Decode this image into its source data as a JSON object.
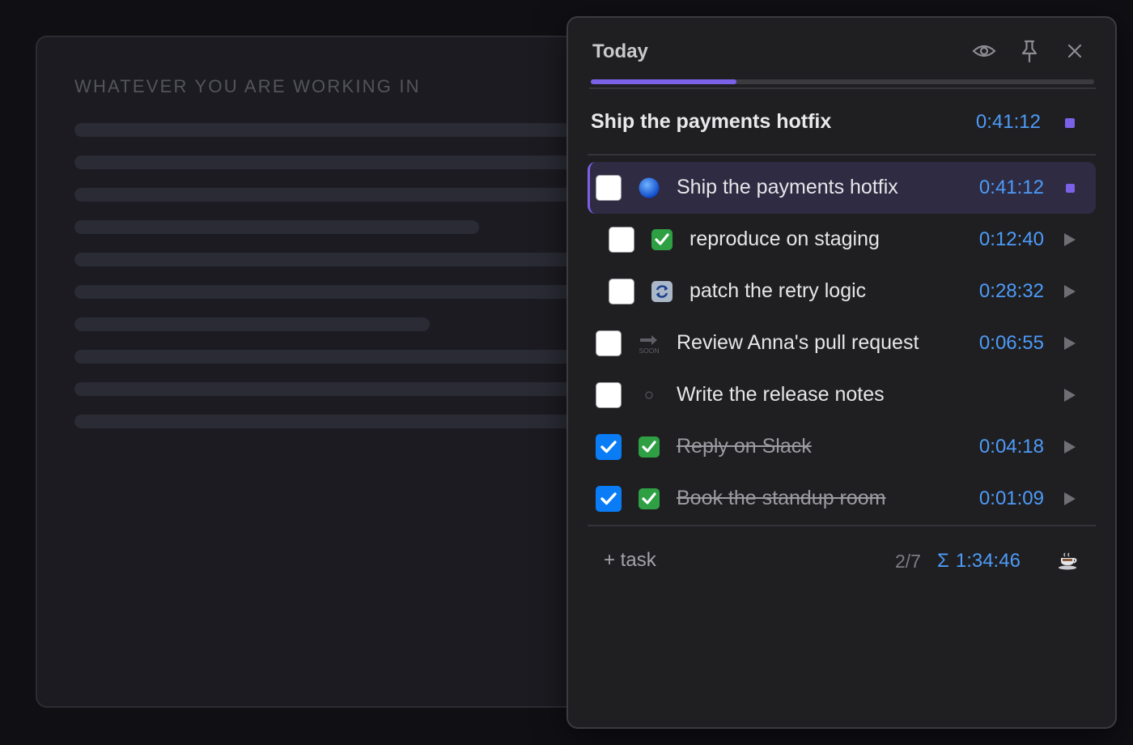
{
  "background": {
    "title": "WHATEVER YOU ARE WORKING IN"
  },
  "panel": {
    "title": "Today",
    "icons": [
      "eye-icon",
      "pin-icon",
      "close-icon"
    ],
    "progress": 0.29,
    "accent_color": "#7b61e8",
    "time_color": "#4d9bf7",
    "current": {
      "name": "Ship the payments hotfix",
      "time": "0:41:12"
    },
    "tasks": [
      {
        "label": "Ship the payments hotfix",
        "time": "0:41:12",
        "icon": "blue-circle-icon",
        "checked": false,
        "indent": false,
        "active": true,
        "action": "stop"
      },
      {
        "label": "reproduce on staging",
        "time": "0:12:40",
        "icon": "check-mark-icon",
        "checked": false,
        "indent": true,
        "active": false,
        "action": "play"
      },
      {
        "label": "patch the retry logic",
        "time": "0:28:32",
        "icon": "refresh-icon",
        "checked": false,
        "indent": true,
        "active": false,
        "action": "play"
      },
      {
        "label": "Review Anna's pull request",
        "time": "0:06:55",
        "icon": "soon-arrow-icon",
        "checked": false,
        "indent": false,
        "active": false,
        "action": "play"
      },
      {
        "label": "Write the release notes",
        "time": "",
        "icon": "empty-circle-icon",
        "checked": false,
        "indent": false,
        "active": false,
        "action": "play"
      },
      {
        "label": "Reply on Slack",
        "time": "0:04:18",
        "icon": "check-mark-icon",
        "checked": true,
        "indent": false,
        "active": false,
        "action": "play"
      },
      {
        "label": "Book the standup room",
        "time": "0:01:09",
        "icon": "check-mark-icon",
        "checked": true,
        "indent": false,
        "active": false,
        "action": "play"
      }
    ],
    "footer": {
      "add_label": "+ task",
      "count": "2/7",
      "sigma": "Σ",
      "total": "1:34:46",
      "break_icon": "coffee-icon"
    }
  }
}
